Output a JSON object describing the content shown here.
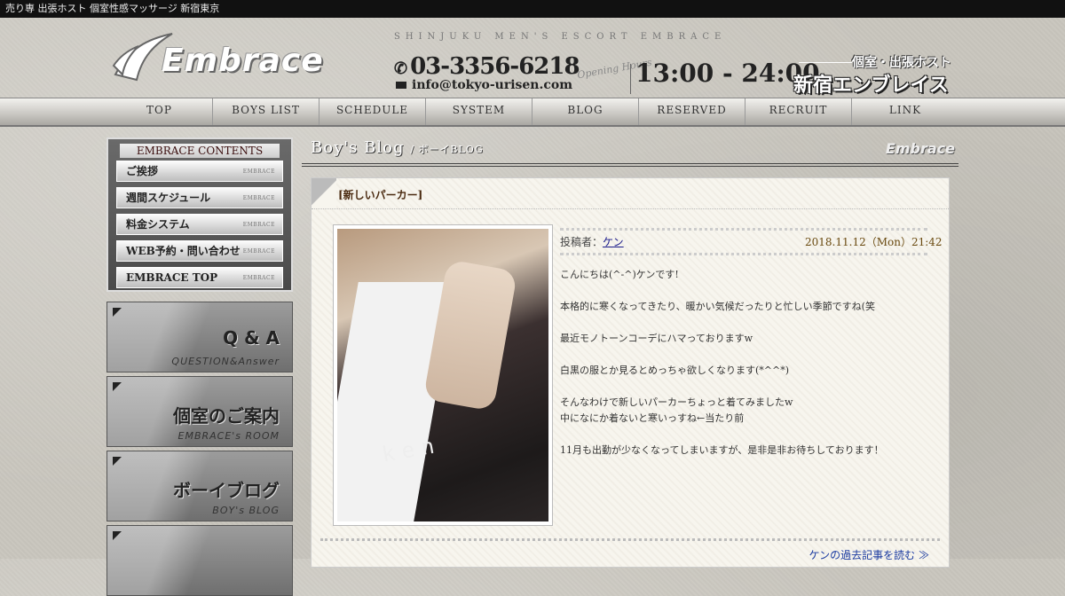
{
  "topbar": {
    "text": "売り専 出張ホスト 個室性感マッサージ 新宿東京"
  },
  "header": {
    "logo_text": "Embrace",
    "tagline": "SHINJUKU MEN'S ESCORT EMBRACE",
    "phone": "03-3356-6218",
    "email": "info@tokyo-urisen.com",
    "hours_label": "Opening Hours",
    "hours": "13:00 - 24:00",
    "shop_sub": "個室・出張ホスト",
    "shop_name": "新宿エンブレイス"
  },
  "nav": {
    "items": [
      {
        "label": "TOP"
      },
      {
        "label": "BOYS LIST"
      },
      {
        "label": "SCHEDULE"
      },
      {
        "label": "SYSTEM"
      },
      {
        "label": "BLOG"
      },
      {
        "label": "RESERVED"
      },
      {
        "label": "RECRUIT"
      },
      {
        "label": "LINK"
      }
    ]
  },
  "sidebar": {
    "contents_title": "EMBRACE CONTENTS",
    "menu_tag": "EMBRACE",
    "menu": [
      {
        "label": "ご挨拶"
      },
      {
        "label": "週間スケジュール"
      },
      {
        "label": "料金システム"
      },
      {
        "label": "WEB予約・問い合わせ"
      },
      {
        "label": "EMBRACE TOP"
      }
    ],
    "banners": [
      {
        "title": "Q & A",
        "sub": "QUESTION&Answer"
      },
      {
        "title": "個室のご案内",
        "sub": "EMBRACE's ROOM"
      },
      {
        "title": "ボーイブログ",
        "sub": "BOY's BLOG"
      }
    ]
  },
  "main": {
    "heading": "Boy's Blog",
    "heading_sub": "/ ボーイBLOG",
    "heading_logo": "Embrace",
    "post": {
      "title": "[新しいパーカー]",
      "author_label": "投稿者：",
      "author": "ケン",
      "date": "2018.11.12（Mon）21:42",
      "photo_text": "ken",
      "lines": [
        "こんにちは(^-^)ケンです!",
        "本格的に寒くなってきたり、暖かい気候だったりと忙しい季節ですね(笑",
        "最近モノトーンコーデにハマっておりますw",
        "白黒の服とか見るとめっちゃ欲しくなります(*^^*)",
        "そんなわけで新しいパーカーちょっと着てみましたw",
        "中になにか着ないと寒いっすね←当たり前",
        "11月も出勤が少なくなってしまいますが、是非是非お待ちしております！"
      ],
      "more_link": "ケンの過去記事を読む ≫"
    }
  }
}
